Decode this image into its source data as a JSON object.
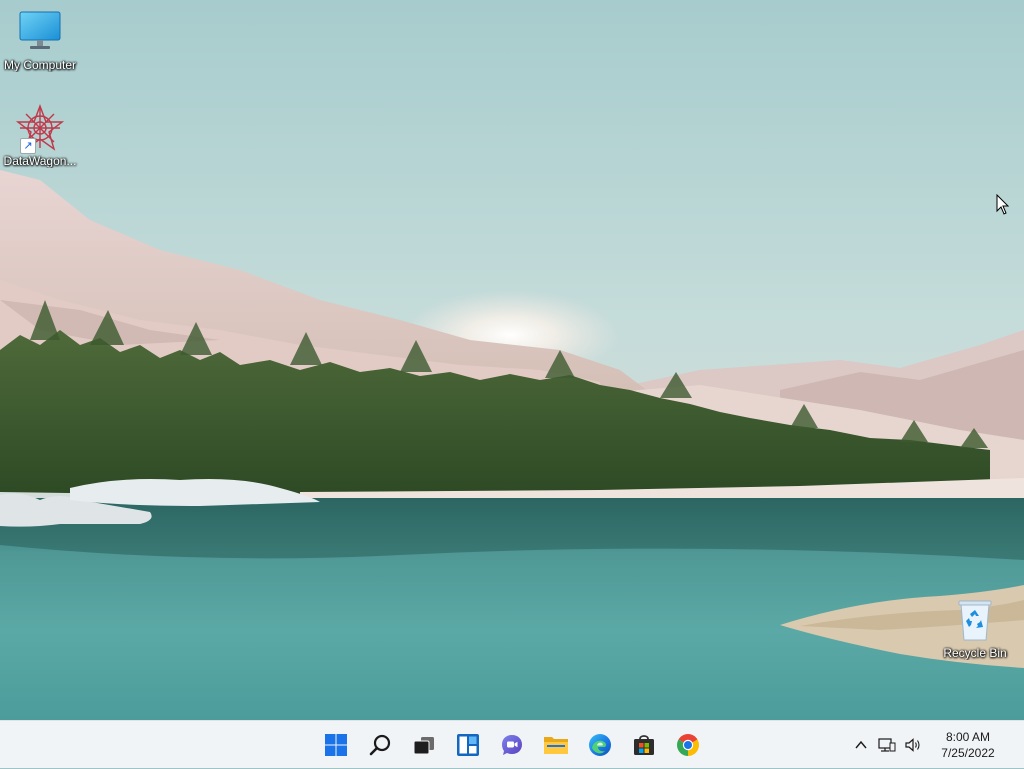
{
  "desktop": {
    "icons": [
      {
        "label": "My Computer",
        "icon": "monitor-icon"
      },
      {
        "label": "DataWagon...",
        "icon": "datawagon-logo-icon"
      },
      {
        "label": "Recycle Bin",
        "icon": "recycle-bin-icon"
      }
    ]
  },
  "taskbar": {
    "items": [
      {
        "name": "Start",
        "icon": "windows-logo-icon"
      },
      {
        "name": "Search",
        "icon": "search-icon"
      },
      {
        "name": "Task View",
        "icon": "task-view-icon"
      },
      {
        "name": "Widgets",
        "icon": "widgets-icon"
      },
      {
        "name": "Chat",
        "icon": "chat-icon"
      },
      {
        "name": "File Explorer",
        "icon": "folder-icon"
      },
      {
        "name": "Microsoft Edge",
        "icon": "edge-icon"
      },
      {
        "name": "Microsoft Store",
        "icon": "store-icon"
      },
      {
        "name": "Google Chrome",
        "icon": "chrome-icon"
      }
    ],
    "tray": {
      "icons": [
        "chevron-up-icon",
        "network-icon",
        "volume-icon"
      ],
      "time": "8:00 AM",
      "date": "7/25/2022"
    }
  },
  "colors": {
    "taskbar_bg": "#f1f4f7",
    "windows_blue": "#1a73e8",
    "sky": "#b9d5d8",
    "water": "#4e9a9c"
  }
}
